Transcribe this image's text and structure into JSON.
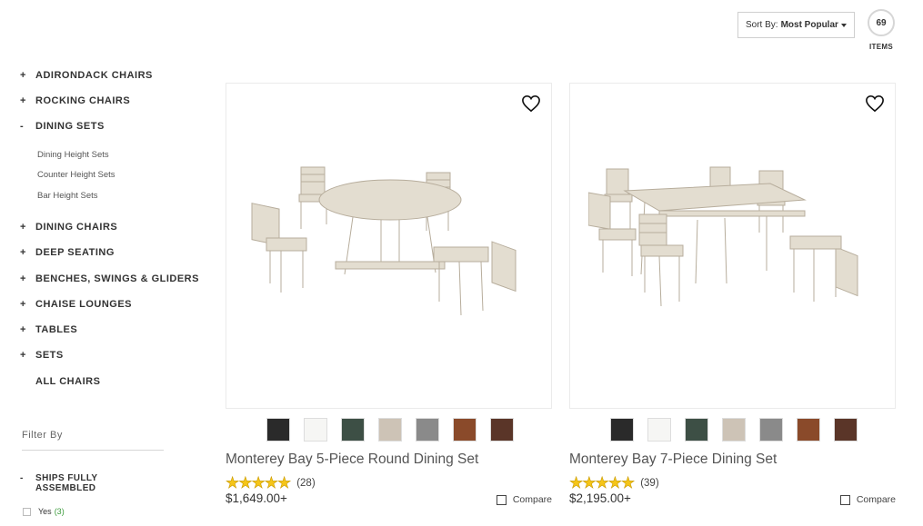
{
  "sort": {
    "label": "Sort By:",
    "value": "Most Popular"
  },
  "items": {
    "count": "69",
    "label": "ITEMS"
  },
  "sidebar": {
    "categories": [
      {
        "symbol": "+",
        "label": "ADIRONDACK CHAIRS"
      },
      {
        "symbol": "+",
        "label": "ROCKING CHAIRS"
      },
      {
        "symbol": "-",
        "label": "DINING SETS"
      },
      {
        "symbol": "+",
        "label": "DINING CHAIRS"
      },
      {
        "symbol": "+",
        "label": "DEEP SEATING"
      },
      {
        "symbol": "+",
        "label": "BENCHES, SWINGS & GLIDERS"
      },
      {
        "symbol": "+",
        "label": "CHAISE LOUNGES"
      },
      {
        "symbol": "+",
        "label": "TABLES"
      },
      {
        "symbol": "+",
        "label": "SETS"
      },
      {
        "symbol": "",
        "label": "ALL CHAIRS"
      }
    ],
    "subcategories": [
      "Dining Height Sets",
      "Counter Height Sets",
      "Bar Height Sets"
    ]
  },
  "filter": {
    "title": "Filter By",
    "group": {
      "symbol": "-",
      "label": "SHIPS FULLY ASSEMBLED"
    },
    "option": {
      "label": "Yes",
      "count": "(3)"
    }
  },
  "products": [
    {
      "name": "Monterey Bay 5-Piece Round Dining Set",
      "stars": "★★★★★",
      "reviews": "(28)",
      "price": "$1,649.00+",
      "compare": "Compare",
      "image_icon": "round-dining-set-photo",
      "swatches": [
        "#2a2a2a",
        "#f6f6f4",
        "#3d4f45",
        "#cdc3b6",
        "#8a8a8a",
        "#8a4a2a",
        "#5a3528"
      ]
    },
    {
      "name": "Monterey Bay 7-Piece Dining Set",
      "stars": "★★★★★",
      "reviews": "(39)",
      "price": "$2,195.00+",
      "compare": "Compare",
      "image_icon": "rectangular-dining-set-photo",
      "swatches": [
        "#2a2a2a",
        "#f6f6f4",
        "#3d4f45",
        "#cdc3b6",
        "#8a8a8a",
        "#8a4a2a",
        "#5a3528"
      ]
    }
  ],
  "colors": {
    "sand": "#e3ddd0",
    "sand_dark": "#b7ad9c",
    "star": "#f5c518"
  }
}
